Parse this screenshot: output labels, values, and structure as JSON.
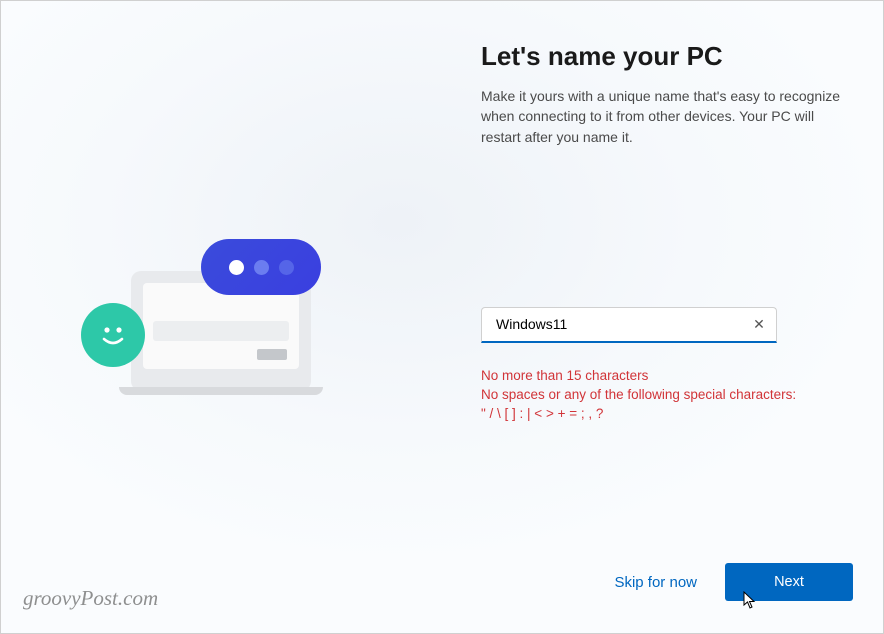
{
  "header": {
    "title": "Let's name your PC",
    "subtitle": "Make it yours with a unique name that's easy to recognize when connecting to it from other devices. Your PC will restart after you name it."
  },
  "input": {
    "value": "Windows11",
    "placeholder": ""
  },
  "validation": {
    "line1": "No more than 15 characters",
    "line2": "No spaces or any of the following special characters:",
    "line3": "\" / \\ [ ] : | < > + = ; , ?"
  },
  "footer": {
    "skip_label": "Skip for now",
    "next_label": "Next"
  },
  "watermark": "groovyPost.com",
  "colors": {
    "accent": "#0067c0",
    "error": "#d13438",
    "smiley": "#2dc8a8",
    "bubble": "#3a4bdb"
  }
}
